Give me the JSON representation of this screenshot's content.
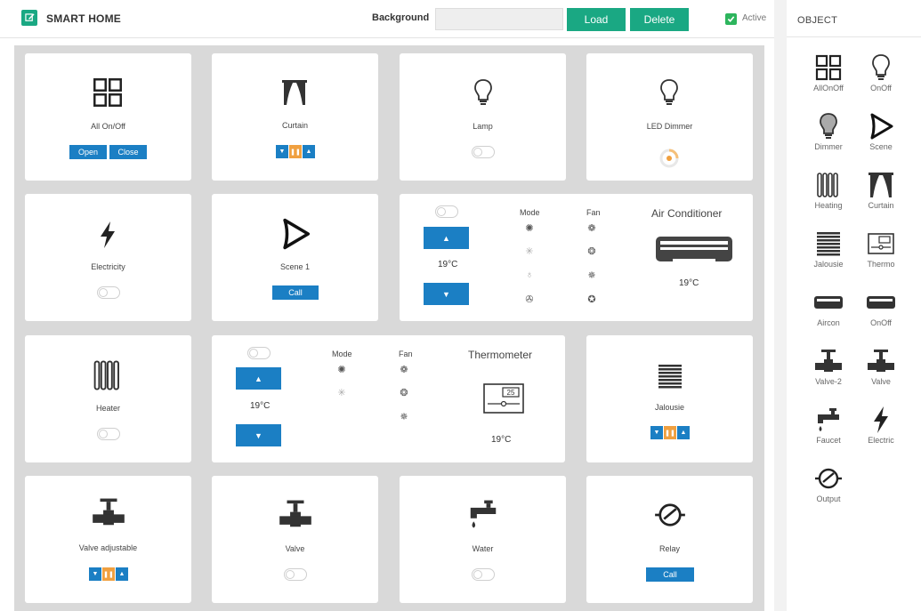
{
  "header": {
    "app_title": "SMART HOME",
    "background_label": "Background",
    "background_value": "",
    "load_label": "Load",
    "delete_label": "Delete",
    "active_label": "Active",
    "active_checked": true,
    "accent_color": "#1aa883"
  },
  "object_panel": {
    "title": "OBJECT",
    "items": [
      {
        "label": "AllOnOff",
        "icon": "grid-icon"
      },
      {
        "label": "OnOff",
        "icon": "bulb-icon"
      },
      {
        "label": "Dimmer",
        "icon": "bulb-filled-icon"
      },
      {
        "label": "Scene",
        "icon": "scene-icon"
      },
      {
        "label": "Heating",
        "icon": "heater-icon"
      },
      {
        "label": "Curtain",
        "icon": "curtain-icon"
      },
      {
        "label": "Jalousie",
        "icon": "jalousie-icon"
      },
      {
        "label": "Thermo",
        "icon": "thermostat-icon"
      },
      {
        "label": "Aircon",
        "icon": "aircon-icon"
      },
      {
        "label": "OnOff",
        "icon": "aircon-icon"
      },
      {
        "label": "Valve-2",
        "icon": "valve-icon"
      },
      {
        "label": "Valve",
        "icon": "valve-icon"
      },
      {
        "label": "Faucet",
        "icon": "faucet-icon"
      },
      {
        "label": "Electric",
        "icon": "lightning-icon"
      },
      {
        "label": "Output",
        "icon": "relay-icon"
      }
    ]
  },
  "cards": {
    "all_onoff": {
      "label": "All On/Off",
      "open_label": "Open",
      "close_label": "Close"
    },
    "curtain": {
      "label": "Curtain"
    },
    "lamp": {
      "label": "Lamp"
    },
    "led_dimmer": {
      "label": "LED Dimmer"
    },
    "electricity": {
      "label": "Electricity"
    },
    "scene1": {
      "label": "Scene 1",
      "call_label": "Call"
    },
    "air_conditioner": {
      "title": "Air Conditioner",
      "mode_label": "Mode",
      "fan_label": "Fan",
      "setpoint": "19°C",
      "current_temp": "19°C"
    },
    "heater": {
      "label": "Heater"
    },
    "thermometer": {
      "title": "Thermometer",
      "mode_label": "Mode",
      "fan_label": "Fan",
      "setpoint": "19°C",
      "current_temp": "19°C",
      "display_value": "25"
    },
    "jalousie": {
      "label": "Jalousie"
    },
    "valve_adjustable": {
      "label": "Valve adjustable"
    },
    "valve": {
      "label": "Valve"
    },
    "water": {
      "label": "Water"
    },
    "relay": {
      "label": "Relay",
      "call_label": "Call"
    }
  },
  "colors": {
    "blue": "#1b7fc4",
    "orange": "#f0a040",
    "grid_bg": "#d9d9d9",
    "green": "#1aa883"
  }
}
